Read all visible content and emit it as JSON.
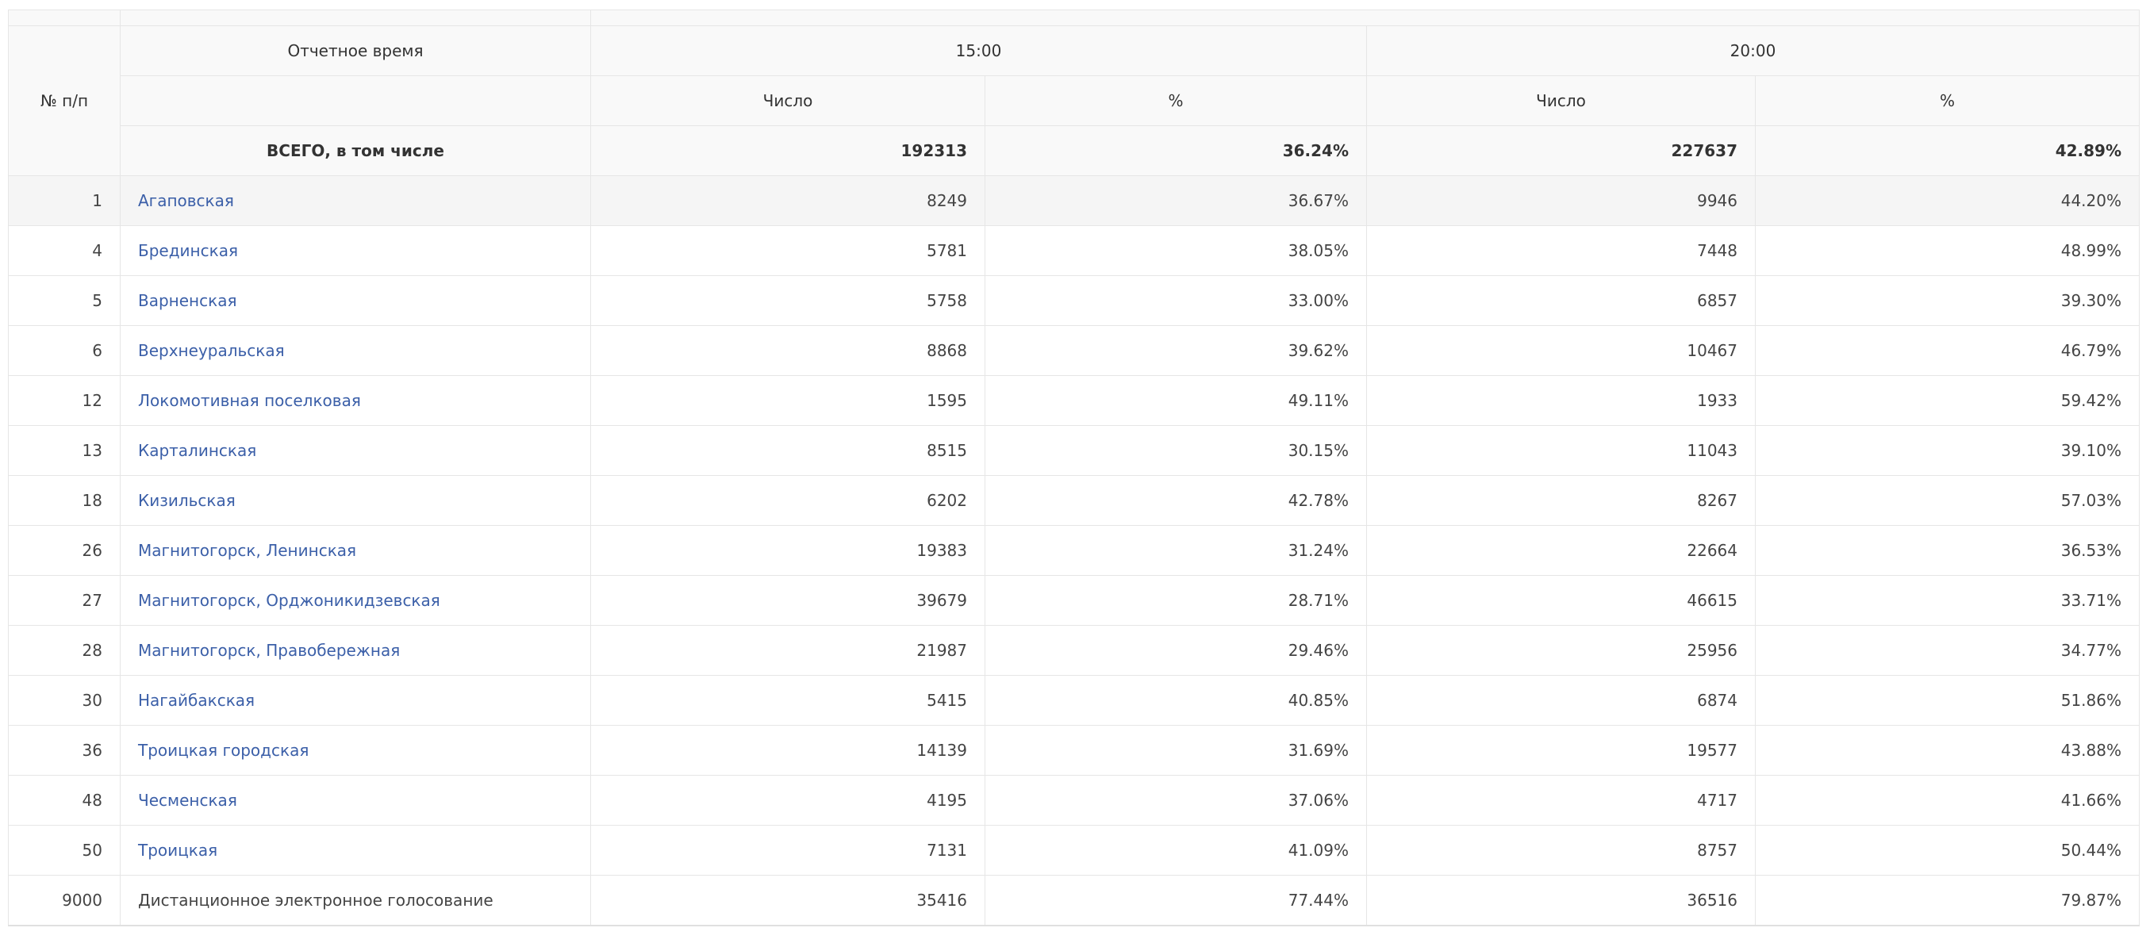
{
  "header": {
    "col_num": "№ п/п",
    "report_time": "Отчетное время",
    "time1": "15:00",
    "time2": "20:00",
    "count": "Число",
    "pct": "%"
  },
  "total": {
    "label": "ВСЕГО, в том числе",
    "c1": "192313",
    "p1": "36.24%",
    "c2": "227637",
    "p2": "42.89%"
  },
  "rows": [
    {
      "num": "1",
      "name": "Агаповская",
      "c1": "8249",
      "p1": "36.67%",
      "c2": "9946",
      "p2": "44.20%"
    },
    {
      "num": "4",
      "name": "Брединская",
      "c1": "5781",
      "p1": "38.05%",
      "c2": "7448",
      "p2": "48.99%"
    },
    {
      "num": "5",
      "name": "Варненская",
      "c1": "5758",
      "p1": "33.00%",
      "c2": "6857",
      "p2": "39.30%"
    },
    {
      "num": "6",
      "name": "Верхнеуральская",
      "c1": "8868",
      "p1": "39.62%",
      "c2": "10467",
      "p2": "46.79%"
    },
    {
      "num": "12",
      "name": "Локомотивная поселковая",
      "c1": "1595",
      "p1": "49.11%",
      "c2": "1933",
      "p2": "59.42%"
    },
    {
      "num": "13",
      "name": "Карталинская",
      "c1": "8515",
      "p1": "30.15%",
      "c2": "11043",
      "p2": "39.10%"
    },
    {
      "num": "18",
      "name": "Кизильская",
      "c1": "6202",
      "p1": "42.78%",
      "c2": "8267",
      "p2": "57.03%"
    },
    {
      "num": "26",
      "name": "Магнитогорск, Ленинская",
      "c1": "19383",
      "p1": "31.24%",
      "c2": "22664",
      "p2": "36.53%"
    },
    {
      "num": "27",
      "name": "Магнитогорск, Орджоникидзевская",
      "c1": "39679",
      "p1": "28.71%",
      "c2": "46615",
      "p2": "33.71%"
    },
    {
      "num": "28",
      "name": "Магнитогорск, Правобережная",
      "c1": "21987",
      "p1": "29.46%",
      "c2": "25956",
      "p2": "34.77%"
    },
    {
      "num": "30",
      "name": "Нагайбакская",
      "c1": "5415",
      "p1": "40.85%",
      "c2": "6874",
      "p2": "51.86%"
    },
    {
      "num": "36",
      "name": "Троицкая городская",
      "c1": "14139",
      "p1": "31.69%",
      "c2": "19577",
      "p2": "43.88%"
    },
    {
      "num": "48",
      "name": "Чесменская",
      "c1": "4195",
      "p1": "37.06%",
      "c2": "4717",
      "p2": "41.66%"
    },
    {
      "num": "50",
      "name": "Троицкая",
      "c1": "7131",
      "p1": "41.09%",
      "c2": "8757",
      "p2": "50.44%"
    },
    {
      "num": "9000",
      "name": "Дистанционное электронное голосование",
      "c1": "35416",
      "p1": "77.44%",
      "c2": "36516",
      "p2": "79.87%"
    }
  ]
}
